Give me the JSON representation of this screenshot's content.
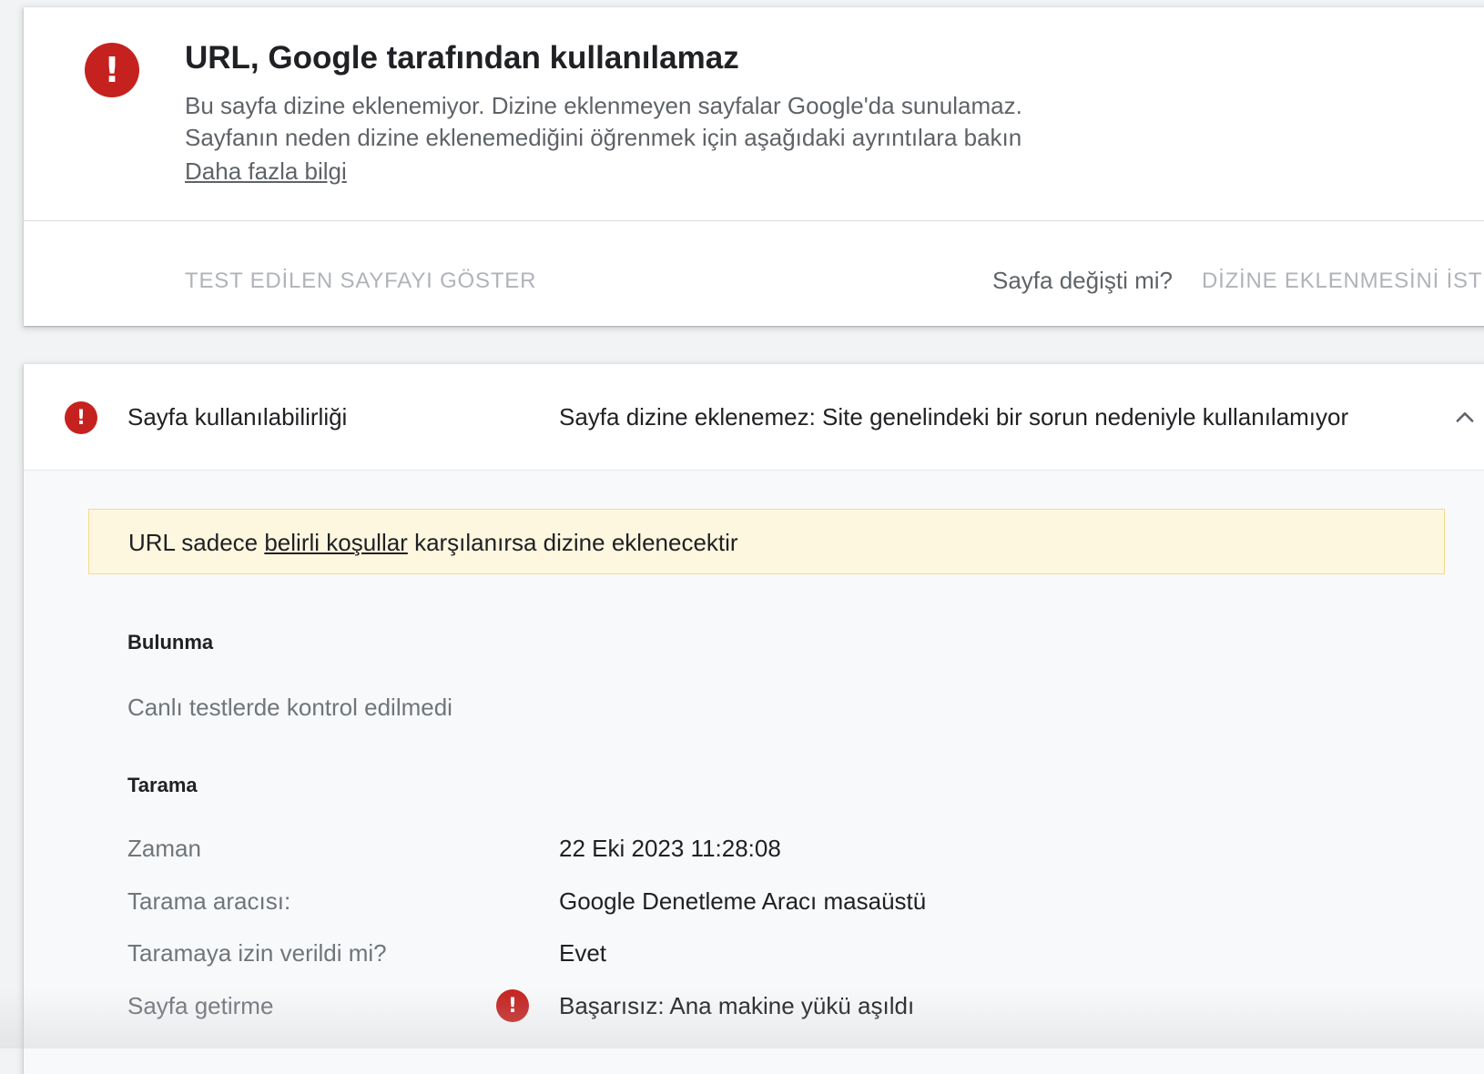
{
  "status_card": {
    "icon": "error-icon",
    "icon_glyph": "!",
    "title": "URL, Google tarafından kullanılamaz",
    "desc_line1": "Bu sayfa dizine eklenemiyor. Dizine eklenmeyen sayfalar Google'da sunulamaz.",
    "desc_line2": "Sayfanın neden dizine eklenemediğini öğrenmek için aşağıdaki ayrıntılara bakın",
    "learn_more": "Daha fazla bilgi",
    "show_tested_page": "TEST EDİLEN SAYFAYI GÖSTER",
    "page_changed": "Sayfa değişti mi?",
    "request_indexing": "DİZİNE EKLENMESİNİ İSTE"
  },
  "detail_card": {
    "header": {
      "icon": "error-icon",
      "icon_glyph": "!",
      "label": "Sayfa kullanılabilirliği",
      "value": "Sayfa dizine eklenemez: Site genelindeki bir sorun nedeniyle kullanılamıyor",
      "toggle_icon": "chevron-up-icon"
    },
    "notice": {
      "prefix": "URL sadece ",
      "link": "belirli koşullar",
      "suffix": " karşılanırsa dizine eklenecektir"
    },
    "discovery": {
      "heading": "Bulunma",
      "text": "Canlı testlerde kontrol edilmedi"
    },
    "crawl": {
      "heading": "Tarama",
      "rows": [
        {
          "label": "Zaman",
          "value": "22 Eki 2023 11:28:08"
        },
        {
          "label": "Tarama aracısı:",
          "value": "Google Denetleme Aracı masaüstü"
        },
        {
          "label": "Taramaya izin verildi mi?",
          "value": "Evet"
        },
        {
          "label": "Sayfa getirme",
          "value": "Başarısız: Ana makine yükü aşıldı",
          "icon": "error-icon",
          "icon_glyph": "!"
        }
      ]
    }
  },
  "colors": {
    "error": "#c5221f",
    "notice_bg": "#fef7e0",
    "notice_border": "#f5d98b",
    "muted_text": "#5f6368",
    "disabled_button": "#b0b3b8"
  }
}
